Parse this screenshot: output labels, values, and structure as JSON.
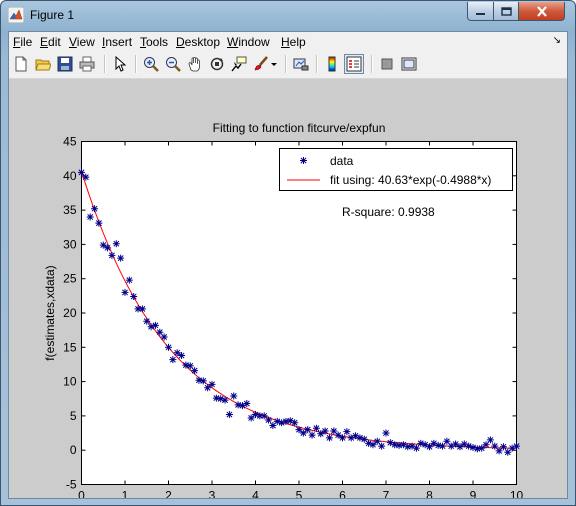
{
  "window": {
    "title": "Figure 1",
    "controls": [
      "minimize",
      "maximize",
      "close"
    ]
  },
  "menu": [
    {
      "key": "F",
      "rest": "ile"
    },
    {
      "key": "E",
      "rest": "dit"
    },
    {
      "key": "V",
      "rest": "iew"
    },
    {
      "key": "I",
      "rest": "nsert"
    },
    {
      "key": "T",
      "rest": "ools"
    },
    {
      "key": "D",
      "rest": "esktop"
    },
    {
      "key": "W",
      "rest": "indow"
    },
    {
      "key": "H",
      "rest": "elp"
    }
  ],
  "toolbar": [
    "new-figure",
    "open-file",
    "save-figure",
    "print-figure",
    "edit-plot",
    "zoom-in",
    "zoom-out",
    "pan",
    "rotate-3d",
    "data-cursor",
    "brush",
    "brush-menu",
    "link-plot",
    "insert-colorbar",
    "insert-legend",
    "hide-plot-tools",
    "show-plot-tools"
  ],
  "chart_data": {
    "type": "scatter",
    "title": "Fitting to function fitcurve/expfun",
    "xlabel": "xdata",
    "ylabel": "f(estimates,xdata)",
    "xlim": [
      0,
      10
    ],
    "ylim": [
      -5,
      45
    ],
    "xticks": [
      0,
      1,
      2,
      3,
      4,
      5,
      6,
      7,
      8,
      9,
      10
    ],
    "yticks": [
      -5,
      0,
      5,
      10,
      15,
      20,
      25,
      30,
      35,
      40,
      45
    ],
    "grid": false,
    "legend_position": "top-right",
    "annotation": "R-square: 0.9938",
    "fit": {
      "A": 40.63,
      "k": 0.4988
    },
    "series": [
      {
        "name": "data",
        "marker": "*",
        "color": "#00008b",
        "x": [
          0,
          0.1,
          0.2,
          0.3,
          0.4,
          0.5,
          0.6,
          0.7,
          0.8,
          0.9,
          1.0,
          1.1,
          1.2,
          1.3,
          1.4,
          1.5,
          1.6,
          1.7,
          1.8,
          1.9,
          2.0,
          2.1,
          2.2,
          2.3,
          2.4,
          2.5,
          2.6,
          2.7,
          2.8,
          2.9,
          3.0,
          3.1,
          3.2,
          3.3,
          3.4,
          3.5,
          3.6,
          3.7,
          3.8,
          3.9,
          4.0,
          4.1,
          4.2,
          4.3,
          4.4,
          4.5,
          4.6,
          4.7,
          4.8,
          4.9,
          5.0,
          5.1,
          5.2,
          5.3,
          5.4,
          5.5,
          5.6,
          5.7,
          5.8,
          5.9,
          6.0,
          6.1,
          6.2,
          6.3,
          6.4,
          6.5,
          6.6,
          6.7,
          6.8,
          6.9,
          7.0,
          7.1,
          7.2,
          7.3,
          7.4,
          7.5,
          7.6,
          7.7,
          7.8,
          7.9,
          8.0,
          8.1,
          8.2,
          8.3,
          8.4,
          8.5,
          8.6,
          8.7,
          8.8,
          8.9,
          9.0,
          9.1,
          9.2,
          9.3,
          9.4,
          9.5,
          9.6,
          9.7,
          9.8,
          9.9,
          10.0
        ],
        "y": [
          40.5,
          39.8,
          34.0,
          35.2,
          33.1,
          29.9,
          29.5,
          28.4,
          30.1,
          28.0,
          23.0,
          24.8,
          22.4,
          20.6,
          20.6,
          18.8,
          18.0,
          18.2,
          17.2,
          16.5,
          15.0,
          13.2,
          14.2,
          13.8,
          12.4,
          12.3,
          11.6,
          10.2,
          10.1,
          9.1,
          9.6,
          7.6,
          7.5,
          7.3,
          5.2,
          7.9,
          6.6,
          6.5,
          6.8,
          4.7,
          5.2,
          5.0,
          5.0,
          4.4,
          3.6,
          4.2,
          4.0,
          4.2,
          4.3,
          4.0,
          3.0,
          2.5,
          3.0,
          2.2,
          3.2,
          2.4,
          2.8,
          1.8,
          2.8,
          2.2,
          1.8,
          2.7,
          1.8,
          2.1,
          1.8,
          1.6,
          1.0,
          0.8,
          1.3,
          0.6,
          2.5,
          1.1,
          0.8,
          0.7,
          0.8,
          0.5,
          0.6,
          0.3,
          1.0,
          0.8,
          0.5,
          1.0,
          0.7,
          0.6,
          1.3,
          0.6,
          0.9,
          0.5,
          0.9,
          0.6,
          0.4,
          0.2,
          0.3,
          0.8,
          1.5,
          0.6,
          -0.1,
          0.5,
          -0.3,
          0.3,
          0.6
        ]
      },
      {
        "name": "fit using: 40.63*exp(-0.4988*x)",
        "style": "line",
        "color": "#ff0000"
      }
    ]
  }
}
